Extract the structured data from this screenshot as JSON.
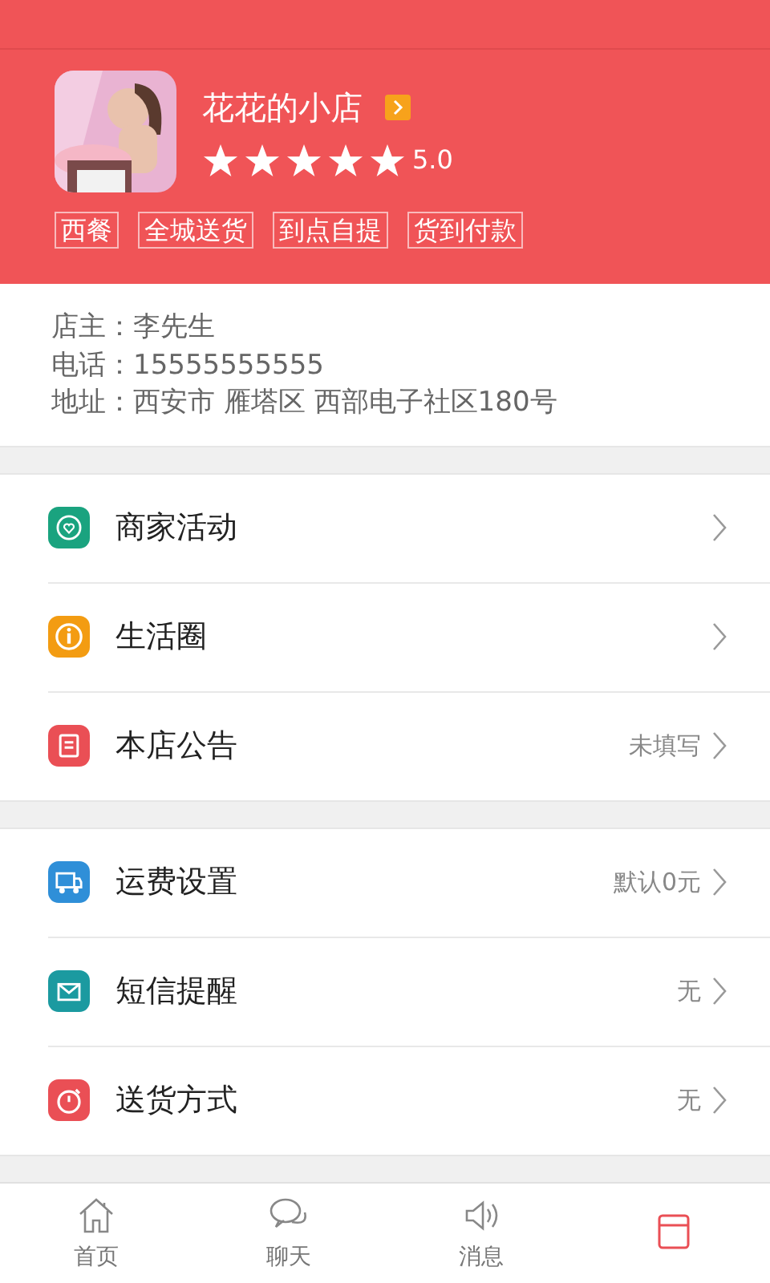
{
  "shop": {
    "name": "花花的小店",
    "stars": 5,
    "rating": "5.0",
    "tags": [
      "西餐",
      "全城送货",
      "到点自提",
      "货到付款"
    ]
  },
  "info": [
    "店主：李先生",
    "电话：15555555555",
    "地址：西安市 雁塔区 西部电子社区180号"
  ],
  "menu_groups": [
    [
      {
        "label": "商家活动"
      },
      {
        "label": "生活圈"
      },
      {
        "label": "本店公告",
        "value": "未填写"
      }
    ],
    [
      {
        "label": "运费设置",
        "value": "默认0元"
      },
      {
        "label": "短信提醒",
        "value": "无"
      },
      {
        "label": "送货方式",
        "value": "无"
      }
    ]
  ],
  "tabs": [
    {
      "label": "首页",
      "selected": false
    },
    {
      "label": "聊天",
      "selected": false
    },
    {
      "label": "消息",
      "selected": false
    },
    {
      "selected": true
    }
  ]
}
